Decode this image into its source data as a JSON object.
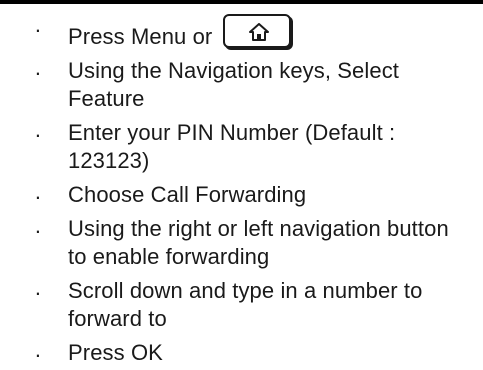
{
  "steps": [
    {
      "text": "Press Menu or",
      "icon": "home-icon"
    },
    {
      "text": "Using the Navigation keys, Select Feature"
    },
    {
      "text": "Enter your PIN Number (Default : 123123)"
    },
    {
      "text": "Choose Call Forwarding"
    },
    {
      "text": "Using the right or left navigation button to enable forwarding"
    },
    {
      "text": "Scroll down and type in a number to forward to"
    },
    {
      "text": "Press OK"
    }
  ],
  "bullet_glyph": "·"
}
